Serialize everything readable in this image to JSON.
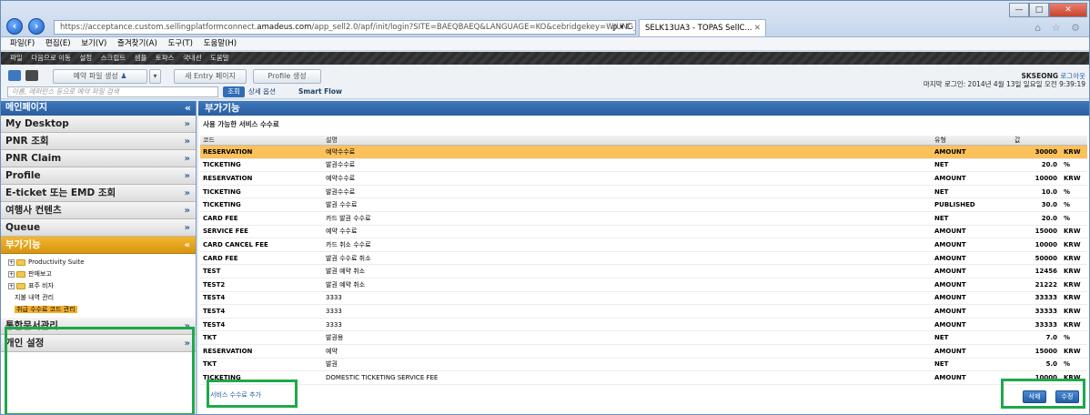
{
  "browser": {
    "url_prefix": "https://acceptance.custom.sellingplatformconnect.",
    "url_host": "amadeus.com",
    "url_rest": "/app_sell2.0/apf/init/login?SITE=BAEQBAEQ&LANGUAGE=KO&cebridgekey=WJUNG_SOL",
    "url_controls": "ρ ▾ C",
    "tab_title": "SELK13UA3 - TOPAS SellC...",
    "tab_close": "✕",
    "win_minimize": "—",
    "win_maximize": "□",
    "win_close": "✕",
    "toolbar_icons": "⌂ ☆ ⚙"
  },
  "menubar": [
    "파일(F)",
    "편집(E)",
    "보기(V)",
    "즐겨찾기(A)",
    "도구(T)",
    "도움말(H)"
  ],
  "appbar": [
    "파일",
    "다음으로 이동",
    "설정",
    "스크립트",
    "샘플",
    "토파스",
    "국내선",
    "도움말"
  ],
  "toolbar": {
    "new_pnr_label": "예약 파일 생성",
    "new_entry_label": "새 Entry 페이지",
    "profile_label": "Profile 생성",
    "search_placeholder": "이름, 레퍼런스 등으로 예약 파일 검색",
    "go_label": "조회",
    "detail_option": "상세 옵션",
    "smart_flow": "Smart Flow"
  },
  "user": {
    "name": "SKSEONG",
    "logout": "로그아웃",
    "last_login": "마지막 로그인: 2014년 4월 13일 일요일 오전 9:39:19"
  },
  "sidebar": {
    "title": "메인페이지",
    "collapse": "«",
    "items": [
      {
        "label": "My Desktop"
      },
      {
        "label": "PNR 조회"
      },
      {
        "label": "PNR Claim"
      },
      {
        "label": "Profile"
      },
      {
        "label": "E-ticket 또는 EMD 조회"
      },
      {
        "label": "여행사 컨텐츠"
      },
      {
        "label": "Queue"
      },
      {
        "label": "부가기능"
      }
    ],
    "tree": [
      {
        "label": "Productivity Suite"
      },
      {
        "label": "판매보고"
      },
      {
        "label": "표주 비자"
      },
      {
        "label": "지불 내역 관리"
      },
      {
        "label": "취급 수수료 코드 관리"
      }
    ],
    "after": [
      {
        "label": "통합문서관리"
      },
      {
        "label": "개인 설정"
      }
    ]
  },
  "main": {
    "title": "부가기능",
    "subtitle": "사용 가능한 서비스 수수료",
    "columns": {
      "code": "코드",
      "desc": "설명",
      "type": "유형",
      "value": "값"
    },
    "rows": [
      {
        "code": "RESERVATION",
        "desc": "예약수수료",
        "type": "AMOUNT",
        "value": "30000",
        "unit": "KRW"
      },
      {
        "code": "TICKETING",
        "desc": "발권수수료",
        "type": "NET",
        "value": "20.0",
        "unit": "%"
      },
      {
        "code": "RESERVATION",
        "desc": "예약수수료",
        "type": "AMOUNT",
        "value": "10000",
        "unit": "KRW"
      },
      {
        "code": "TICKETING",
        "desc": "발권수수료",
        "type": "NET",
        "value": "10.0",
        "unit": "%"
      },
      {
        "code": "TICKETING",
        "desc": "발권 수수료",
        "type": "PUBLISHED",
        "value": "30.0",
        "unit": "%"
      },
      {
        "code": "CARD FEE",
        "desc": "카드 발권 수수료",
        "type": "NET",
        "value": "20.0",
        "unit": "%"
      },
      {
        "code": "SERVICE FEE",
        "desc": "예약 수수료",
        "type": "AMOUNT",
        "value": "15000",
        "unit": "KRW"
      },
      {
        "code": "CARD CANCEL FEE",
        "desc": "카드 취소 수수료",
        "type": "AMOUNT",
        "value": "10000",
        "unit": "KRW"
      },
      {
        "code": "CARD FEE",
        "desc": "발권 수수료 취소",
        "type": "AMOUNT",
        "value": "50000",
        "unit": "KRW"
      },
      {
        "code": "TEST",
        "desc": "발권 예약 취소",
        "type": "AMOUNT",
        "value": "12456",
        "unit": "KRW"
      },
      {
        "code": "TEST2",
        "desc": "발권 예약 취소",
        "type": "AMOUNT",
        "value": "21222",
        "unit": "KRW"
      },
      {
        "code": "TEST4",
        "desc": "3333",
        "type": "AMOUNT",
        "value": "33333",
        "unit": "KRW"
      },
      {
        "code": "TEST4",
        "desc": "3333",
        "type": "AMOUNT",
        "value": "33333",
        "unit": "KRW"
      },
      {
        "code": "TEST4",
        "desc": "3333",
        "type": "AMOUNT",
        "value": "33333",
        "unit": "KRW"
      },
      {
        "code": "TKT",
        "desc": "발권용",
        "type": "NET",
        "value": "7.0",
        "unit": "%"
      },
      {
        "code": "RESERVATION",
        "desc": "예약",
        "type": "AMOUNT",
        "value": "15000",
        "unit": "KRW"
      },
      {
        "code": "TKT",
        "desc": "발권",
        "type": "NET",
        "value": "5.0",
        "unit": "%"
      },
      {
        "code": "TICKETING",
        "desc": "DOMESTIC TICKETING SERVICE FEE",
        "type": "AMOUNT",
        "value": "10000",
        "unit": "KRW"
      }
    ],
    "add_link": "서비스 수수료 추가",
    "delete_label": "삭제",
    "edit_label": "수정"
  },
  "colors": {
    "accent_blue": "#2a5e9e",
    "active_orange": "#e0a11a",
    "selected_row": "#fbc15b",
    "highlight_green": "#1fa84a"
  }
}
